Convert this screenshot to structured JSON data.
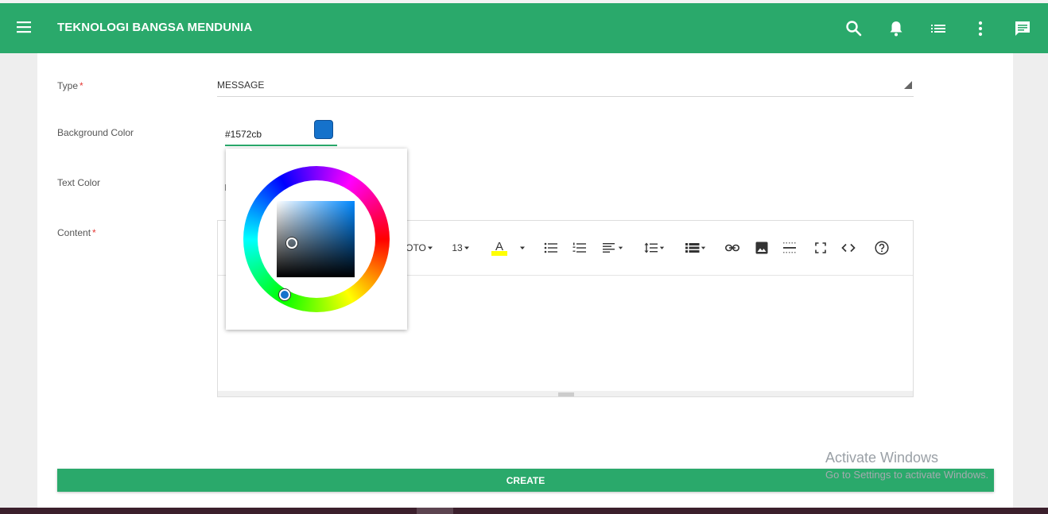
{
  "appbar": {
    "title": "TEKNOLOGI BANGSA MENDUNIA",
    "icons": [
      "menu-icon",
      "search-icon",
      "bell-icon",
      "list-icon",
      "more-vert-icon",
      "chat-icon"
    ],
    "color": "#2aa96b"
  },
  "form": {
    "type": {
      "label": "Type",
      "required": "*",
      "value": "MESSAGE"
    },
    "background_color": {
      "label": "Background Color",
      "value": "#1572cb",
      "swatch": "#1572cb"
    },
    "text_color": {
      "label": "Text Color"
    },
    "content": {
      "label": "Content",
      "required": "*",
      "toolbar": {
        "font_name": "OTO",
        "font_size": "13",
        "highlight_letter": "A",
        "highlight_color": "#ffff00",
        "icons": [
          "unordered-list-icon",
          "ordered-list-icon",
          "align-icon",
          "line-height-icon",
          "table-icon",
          "link-icon",
          "image-icon",
          "hr-icon",
          "fullscreen-icon",
          "code-view-icon",
          "help-icon"
        ]
      }
    }
  },
  "picker": {
    "hue_handle": "#1572cb",
    "square_hue": "#0088ff"
  },
  "create_label": "CREATE",
  "watermark": {
    "title": "Activate Windows",
    "subtitle": "Go to Settings to activate Windows."
  }
}
